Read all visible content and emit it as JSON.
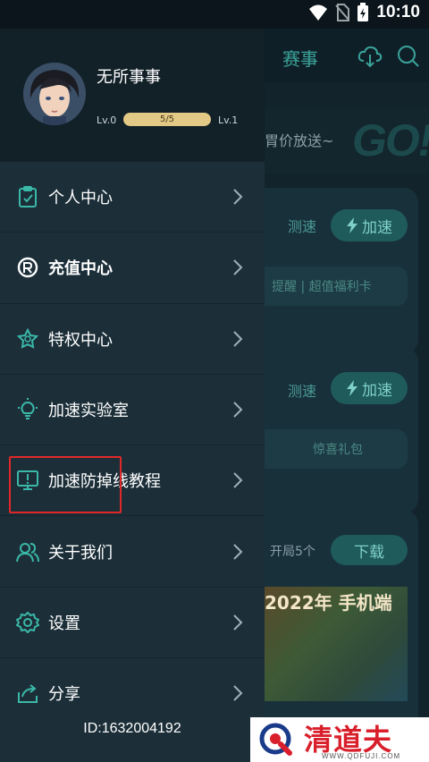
{
  "status_bar": {
    "time": "10:10",
    "icons": [
      "wifi-icon",
      "no-sim-icon",
      "battery-charging-icon"
    ]
  },
  "background_app": {
    "tab_label": "赛事",
    "banner_text": "胃价放送~",
    "banner_brand": "GO!",
    "card1": {
      "speedtest": "测速",
      "accelerate": "加速",
      "strip": "提醒  |  超值福利卡"
    },
    "card2": {
      "speedtest": "测速",
      "accelerate": "加速",
      "strip": "惊喜礼包"
    },
    "card3": {
      "opens": "开局5个",
      "download": "下载",
      "image_title": "2022年 手机端"
    }
  },
  "drawer": {
    "username": "无所事事",
    "level_from": "Lv.0",
    "level_progress_text": "5/5",
    "level_progress_fraction": 1.0,
    "level_to": "Lv.1",
    "menu": [
      {
        "label": "个人中心",
        "icon": "clipboard-icon"
      },
      {
        "label": "充值中心",
        "icon": "recharge-coin-icon"
      },
      {
        "label": "特权中心",
        "icon": "privilege-badge-icon"
      },
      {
        "label": "加速实验室",
        "icon": "lightbulb-icon"
      },
      {
        "label": "加速防掉线教程",
        "icon": "monitor-alert-icon"
      },
      {
        "label": "关于我们",
        "icon": "users-icon"
      },
      {
        "label": "设置",
        "icon": "gear-icon"
      },
      {
        "label": "分享",
        "icon": "share-icon"
      }
    ],
    "footer_id": "ID:1632004192"
  },
  "watermark": {
    "brand": "清道夫",
    "url": "WWW.QDFUJI.COM"
  },
  "colors": {
    "drawer_bg": "#1c2f39",
    "profile_bg": "#122028",
    "accent_teal": "#3aa39a",
    "level_bar": "#e3c986",
    "highlight_red": "#e02828",
    "watermark_red": "#d91f2b"
  }
}
